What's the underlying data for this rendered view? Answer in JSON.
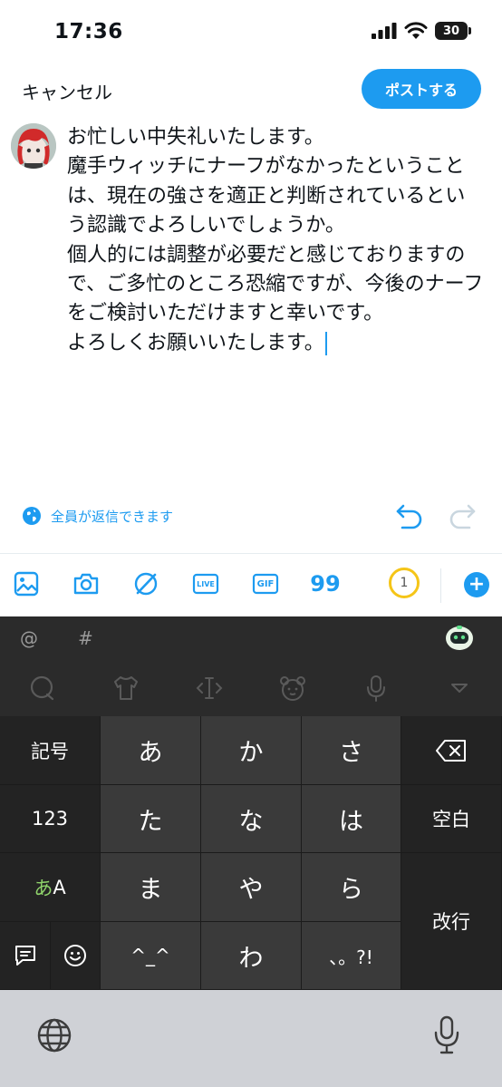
{
  "status": {
    "time": "17:36",
    "battery": "30"
  },
  "compose": {
    "cancel_label": "キャンセル",
    "post_label": "ポストする",
    "text": "お忙しい中失礼いたします。\n魔手ウィッチにナーフがなかったということは、現在の強さを適正と判断されているという認識でよろしいでしょうか。\n個人的には調整が必要だと感じておりますので、ご多忙のところ恐縮ですが、今後のナーフをご検討いただけますと幸いです。\nよろしくお願いいたします。",
    "reply_setting": "全員が返信できます"
  },
  "toolbar": {
    "live_label": "LIVE",
    "gif_label": "GIF",
    "quote_glyph": "99",
    "char_counter": "1",
    "add_glyph": "+"
  },
  "keyboard": {
    "at": "@",
    "hash": "#",
    "keys": {
      "symbols": "記号",
      "numbers": "123",
      "kana_a": "あ",
      "alpha_A": "A",
      "space": "空白",
      "enter": "改行",
      "a": "あ",
      "ka": "か",
      "sa": "さ",
      "ta": "た",
      "na": "な",
      "ha": "は",
      "ma": "ま",
      "ya": "や",
      "ra": "ら",
      "kaomoji": "^_^",
      "wa": "わ",
      "punct": "、。?!"
    }
  },
  "colors": {
    "accent": "#1d9bf0",
    "keyboard_bg": "#2b2b2b",
    "key_main": "#3a3a3a",
    "counter_ring": "#f5c518",
    "kana_green": "#8fd36b"
  }
}
